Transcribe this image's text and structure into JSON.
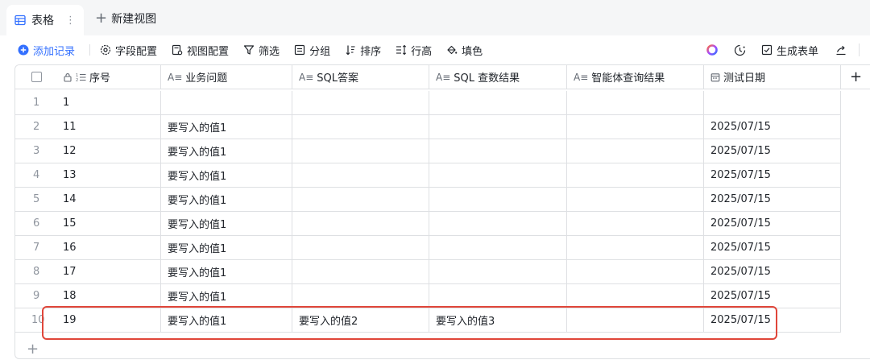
{
  "tabs": {
    "active_label": "表格",
    "new_view_label": "新建视图"
  },
  "toolbar": {
    "add_record": "添加记录",
    "field_config": "字段配置",
    "view_config": "视图配置",
    "filter": "筛选",
    "group": "分组",
    "sort": "排序",
    "row_height": "行高",
    "fill_color": "填色",
    "generate_form": "生成表单"
  },
  "columns": {
    "seq": "序号",
    "business_question": "业务问题",
    "sql_answer": "SQL答案",
    "sql_result": "SQL 查数结果",
    "agent_result": "智能体查询结果",
    "test_date": "测试日期"
  },
  "rows": [
    {
      "index": "1",
      "seq": "1",
      "question": "",
      "sql_answer": "",
      "sql_result": "",
      "agent_result": "",
      "date": ""
    },
    {
      "index": "2",
      "seq": "11",
      "question": "要写入的值1",
      "sql_answer": "",
      "sql_result": "",
      "agent_result": "",
      "date": "2025/07/15"
    },
    {
      "index": "3",
      "seq": "12",
      "question": "要写入的值1",
      "sql_answer": "",
      "sql_result": "",
      "agent_result": "",
      "date": "2025/07/15"
    },
    {
      "index": "4",
      "seq": "13",
      "question": "要写入的值1",
      "sql_answer": "",
      "sql_result": "",
      "agent_result": "",
      "date": "2025/07/15"
    },
    {
      "index": "5",
      "seq": "14",
      "question": "要写入的值1",
      "sql_answer": "",
      "sql_result": "",
      "agent_result": "",
      "date": "2025/07/15"
    },
    {
      "index": "6",
      "seq": "15",
      "question": "要写入的值1",
      "sql_answer": "",
      "sql_result": "",
      "agent_result": "",
      "date": "2025/07/15"
    },
    {
      "index": "7",
      "seq": "16",
      "question": "要写入的值1",
      "sql_answer": "",
      "sql_result": "",
      "agent_result": "",
      "date": "2025/07/15"
    },
    {
      "index": "8",
      "seq": "17",
      "question": "要写入的值1",
      "sql_answer": "",
      "sql_result": "",
      "agent_result": "",
      "date": "2025/07/15"
    },
    {
      "index": "9",
      "seq": "18",
      "question": "要写入的值1",
      "sql_answer": "",
      "sql_result": "",
      "agent_result": "",
      "date": "2025/07/15"
    },
    {
      "index": "10",
      "seq": "19",
      "question": "要写入的值1",
      "sql_answer": "要写入的值2",
      "sql_result": "要写入的值3",
      "agent_result": "",
      "date": "2025/07/15"
    }
  ],
  "highlighted_row_index": "10",
  "colors": {
    "accent": "#3370ff",
    "highlight": "#e0463a",
    "border": "#dee0e3",
    "muted": "#8f959e"
  }
}
